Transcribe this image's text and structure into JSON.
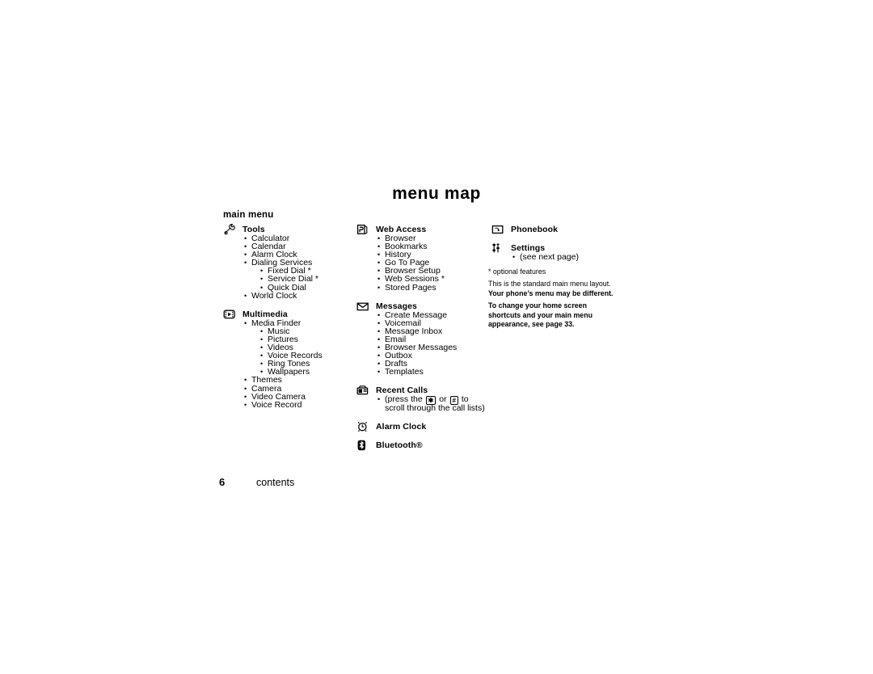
{
  "document": {
    "title": "menu map",
    "section_label": "main menu"
  },
  "footer": {
    "page_number": "6",
    "label": "contents"
  },
  "columns": [
    {
      "id": "column-1",
      "groups": [
        {
          "icon": "tools-icon",
          "label": "Tools",
          "items": [
            {
              "label": "Calculator"
            },
            {
              "label": "Calendar"
            },
            {
              "label": "Alarm Clock"
            },
            {
              "label": "Dialing Services",
              "children": [
                {
                  "label": "Fixed Dial *"
                },
                {
                  "label": "Service Dial *"
                },
                {
                  "label": "Quick Dial"
                }
              ]
            },
            {
              "label": "World Clock"
            }
          ]
        },
        {
          "icon": "multimedia-icon",
          "label": "Multimedia",
          "items": [
            {
              "label": "Media Finder",
              "children": [
                {
                  "label": "Music"
                },
                {
                  "label": "Pictures"
                },
                {
                  "label": "Videos"
                },
                {
                  "label": "Voice Records"
                },
                {
                  "label": "Ring Tones"
                },
                {
                  "label": "Wallpapers"
                }
              ]
            },
            {
              "label": "Themes"
            },
            {
              "label": "Camera"
            },
            {
              "label": "Video Camera"
            },
            {
              "label": "Voice Record"
            }
          ]
        }
      ]
    },
    {
      "id": "column-2",
      "groups": [
        {
          "icon": "web-access-icon",
          "label": "Web Access",
          "items": [
            {
              "label": "Browser"
            },
            {
              "label": "Bookmarks"
            },
            {
              "label": "History"
            },
            {
              "label": "Go To Page"
            },
            {
              "label": "Browser Setup"
            },
            {
              "label": "Web Sessions *"
            },
            {
              "label": "Stored Pages"
            }
          ]
        },
        {
          "icon": "messages-envelope-icon",
          "label": "Messages",
          "items": [
            {
              "label": "Create Message"
            },
            {
              "label": "Voicemail"
            },
            {
              "label": "Message Inbox"
            },
            {
              "label": "Email"
            },
            {
              "label": "Browser Messages"
            },
            {
              "label": "Outbox"
            },
            {
              "label": "Drafts"
            },
            {
              "label": "Templates"
            }
          ]
        },
        {
          "icon": "recent-calls-icon",
          "label": "Recent Calls",
          "note_parts": {
            "before": "(press the",
            "key1": "✱",
            "middle": "or",
            "key2": "#",
            "after": "to scroll through the call lists)"
          }
        },
        {
          "icon": "alarm-clock-icon",
          "label": "Alarm Clock",
          "items": []
        },
        {
          "icon": "bluetooth-icon",
          "label": "Bluetooth®",
          "items": []
        }
      ]
    },
    {
      "id": "column-3",
      "groups": [
        {
          "icon": "phonebook-icon",
          "label": "Phonebook",
          "items": []
        },
        {
          "icon": "settings-icon",
          "label": "Settings",
          "items": [
            {
              "label": "(see next page)"
            }
          ]
        }
      ]
    }
  ],
  "note": {
    "optional": "* optional features",
    "para1_normal": "This is the standard main menu layout. ",
    "para1_bold": "Your phone’s menu may be different.",
    "para2_bold": "To change your home screen shortcuts and your main menu appearance, see page 33."
  }
}
